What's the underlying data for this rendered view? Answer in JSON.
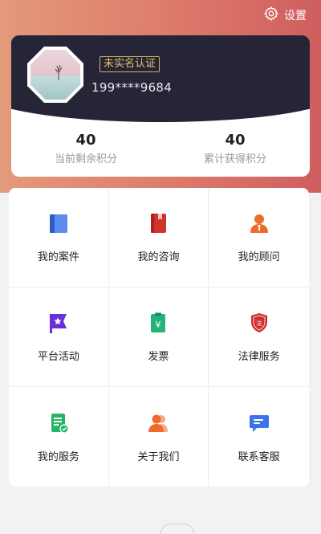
{
  "header": {
    "settings_label": "设置"
  },
  "profile": {
    "badge": "未实名认证",
    "phone": "199****9684",
    "stats": [
      {
        "value": "40",
        "label": "当前剩余积分"
      },
      {
        "value": "40",
        "label": "累计获得积分"
      }
    ]
  },
  "menu": [
    {
      "label": "我的案件",
      "icon": "folder-icon",
      "color": "#3b6fe0"
    },
    {
      "label": "我的咨询",
      "icon": "book-icon",
      "color": "#d0322f"
    },
    {
      "label": "我的顾问",
      "icon": "person-icon",
      "color": "#ef6b2c"
    },
    {
      "label": "平台活动",
      "icon": "flag-icon",
      "color": "#6a2fd8"
    },
    {
      "label": "发票",
      "icon": "invoice-icon",
      "color": "#25b27a"
    },
    {
      "label": "法律服务",
      "icon": "law-shield-icon",
      "color": "#cf2f2f"
    },
    {
      "label": "我的服务",
      "icon": "service-doc-icon",
      "color": "#26b36a"
    },
    {
      "label": "关于我们",
      "icon": "people-icon",
      "color": "#ef6b2c"
    },
    {
      "label": "联系客服",
      "icon": "chat-icon",
      "color": "#3d73e6"
    }
  ]
}
